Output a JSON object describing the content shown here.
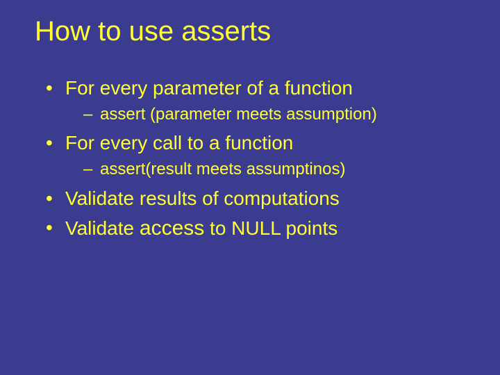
{
  "title": "How to use asserts",
  "bullets": [
    {
      "text": "For every parameter of a function",
      "sub": [
        "assert (parameter meets assumption)"
      ]
    },
    {
      "text": "For every call to a function",
      "sub": [
        "assert(result meets assumptinos)"
      ]
    },
    {
      "text": "Validate results of computations"
    },
    {
      "textParts": {
        "pre": "Validate ",
        "emph": "access",
        "post": " to NULL points"
      }
    }
  ]
}
